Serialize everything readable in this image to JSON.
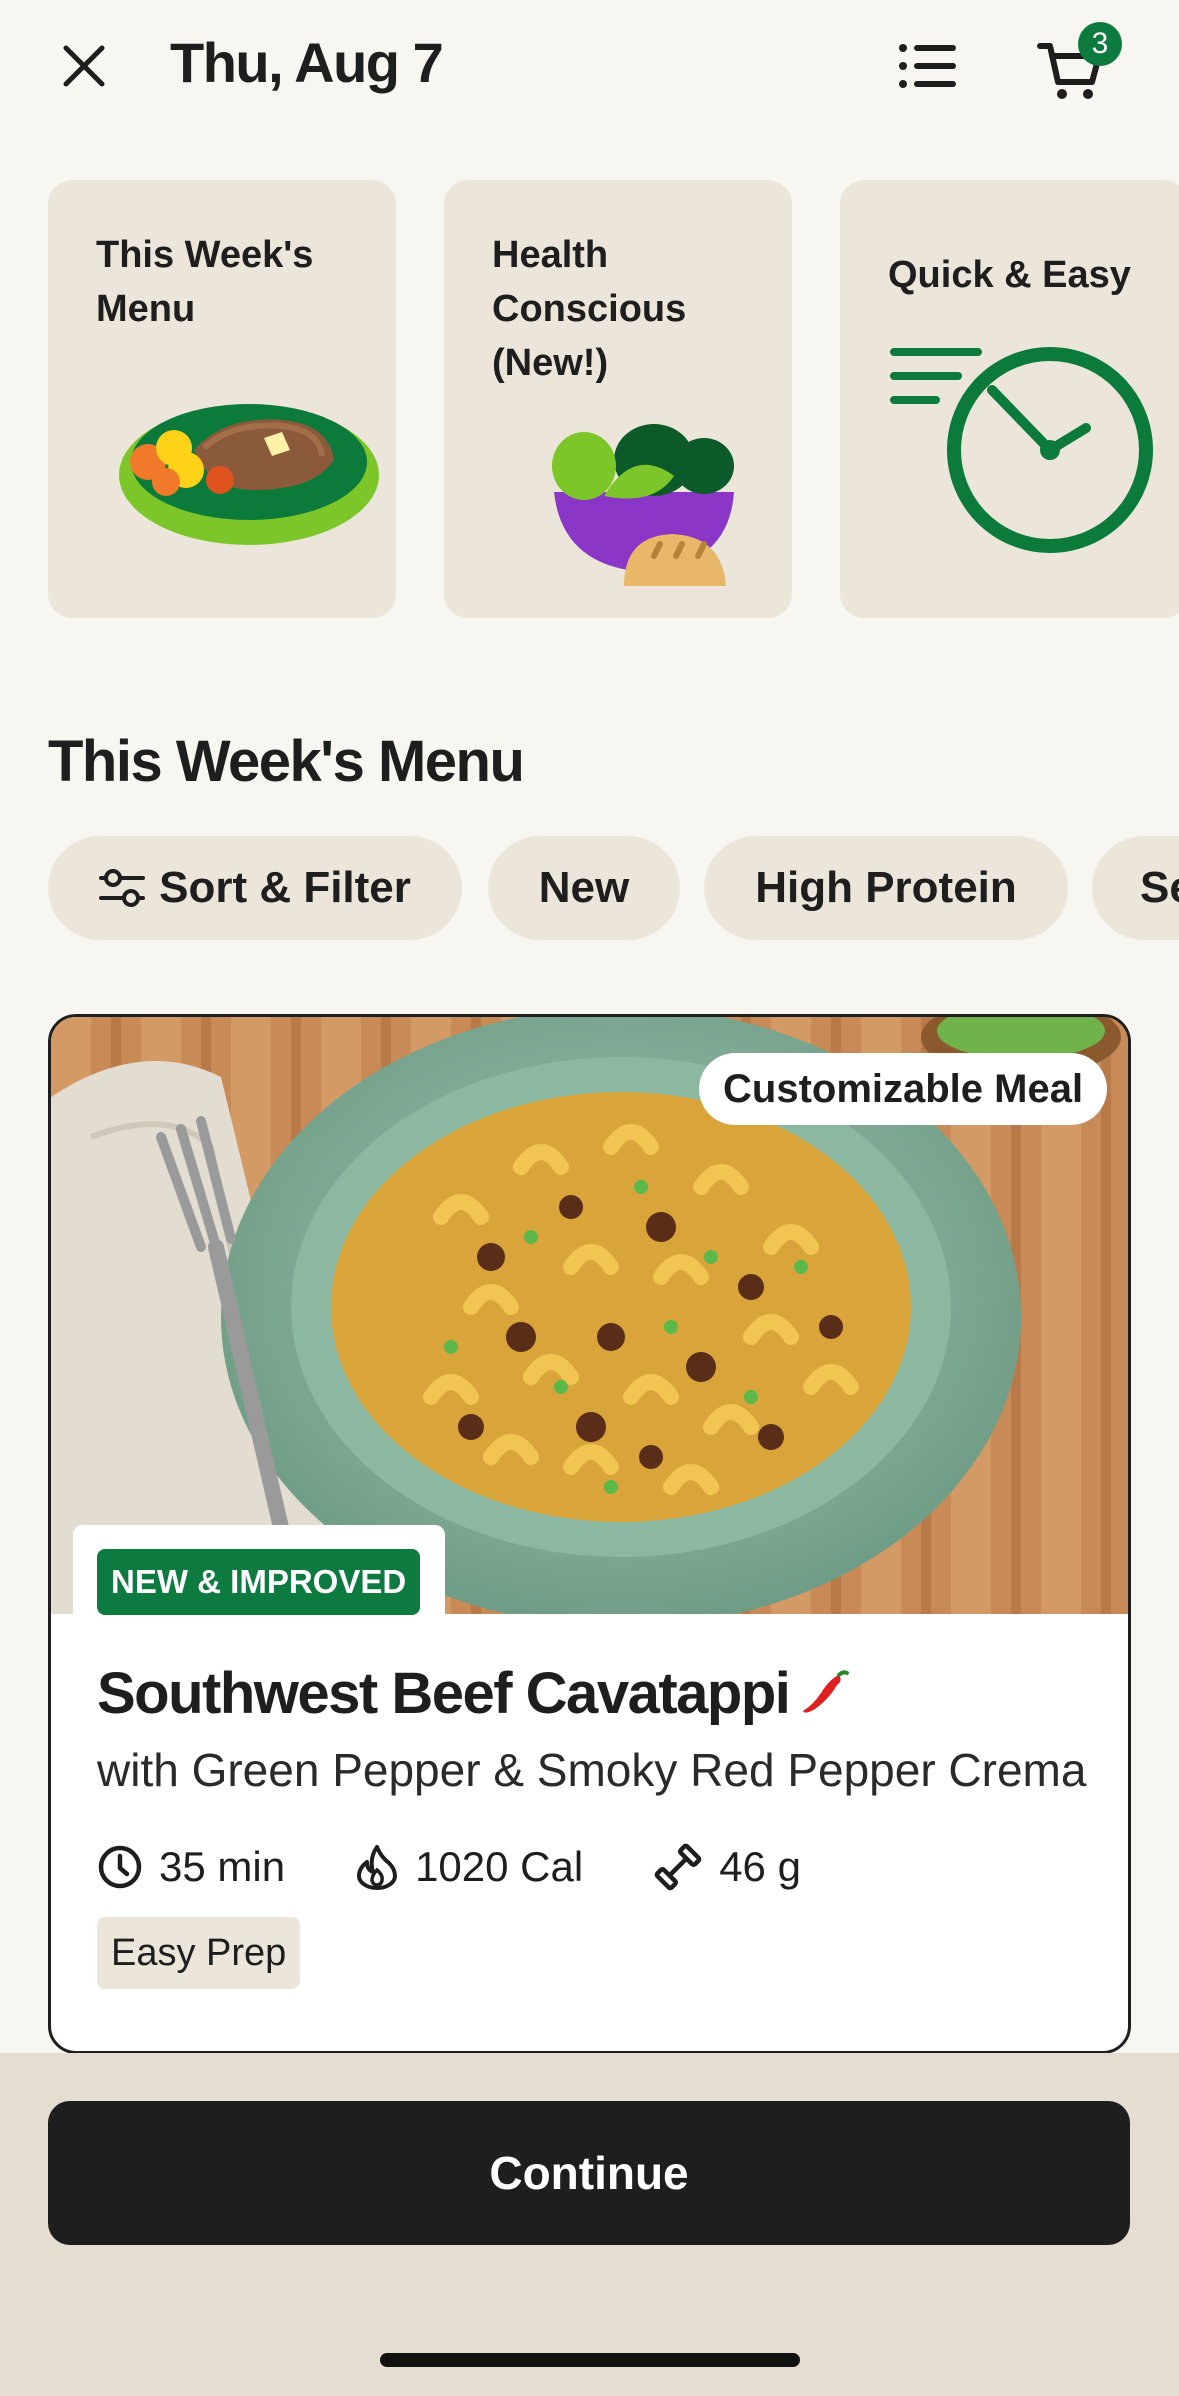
{
  "header": {
    "date": "Thu, Aug 7",
    "cart_count": "3",
    "close_icon": "close-icon",
    "list_icon": "list-icon",
    "cart_icon": "cart-icon"
  },
  "categories": [
    {
      "label": "This Week's Menu",
      "icon": "meal-bowl-illustration"
    },
    {
      "label": "Health Conscious (New!)",
      "icon": "salad-bowl-illustration"
    },
    {
      "label": "Quick & Easy",
      "icon": "clock-illustration"
    }
  ],
  "section": {
    "title": "This Week's Menu"
  },
  "chips": [
    {
      "label": "Sort & Filter",
      "icon": "sliders-icon"
    },
    {
      "label": "New"
    },
    {
      "label": "High Protein"
    },
    {
      "label": "Se"
    }
  ],
  "meal": {
    "badge": "Customizable Meal",
    "tag": "NEW & IMPROVED",
    "name": "Southwest Beef Cavatappi",
    "spice_icon": "chili-pepper-icon",
    "subtitle": "with Green Pepper & Smoky Red Pepper Crema",
    "time": "35 min",
    "calories": "1020 Cal",
    "protein": "46 g",
    "prep": "Easy Prep"
  },
  "footer": {
    "continue_label": "Continue"
  },
  "colors": {
    "background": "#f8f6f1",
    "card": "#ece6da",
    "brand_green": "#0d7a3f",
    "button_dark": "#1e1e1e",
    "footer": "#e5ddd0"
  }
}
